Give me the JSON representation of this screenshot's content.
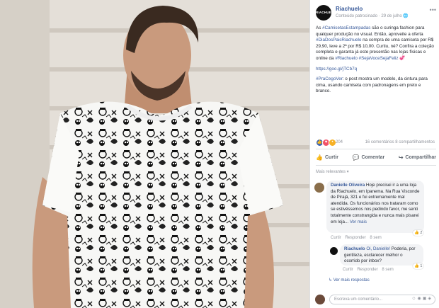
{
  "post": {
    "page_name": "Riachuelo",
    "logo_text": "RIACHUELO",
    "author_meta": "Conteúdo patrocinado",
    "date": "29 de julho",
    "body_p1_parts": [
      {
        "text": "As ",
        "type": "text"
      },
      {
        "text": "#CamisetasEstampadas",
        "type": "link"
      },
      {
        "text": " são o curinga fashion para qualquer produção no visual. Então, aproveite a oferta ",
        "type": "text"
      },
      {
        "text": "#DiaDosPaisRiachuelo",
        "type": "link"
      },
      {
        "text": " na compra de uma camiseta por R$ 29,90, leve a 2ª por R$ 10,00. Curtiu, né? Confira a coleção completa e garanta já este presentão nas lojas físicas e online da ",
        "type": "text"
      },
      {
        "text": "#Riachuelo",
        "type": "link"
      },
      {
        "text": " ",
        "type": "text"
      },
      {
        "text": "#SejaVoceSejaFeliz",
        "type": "link"
      },
      {
        "text": " 💞",
        "type": "text"
      }
    ],
    "short_link": "https://goo.gl/jTCb7q",
    "body_p3_tag": "#PraCegoVer",
    "body_p3_text": ": o post mostra um modelo, da cintura para cima, usando camiseta com padronagens em preto e branco."
  },
  "reactions": {
    "count": "204",
    "comments": "16 comentários",
    "shares": "8 compartilhamentos"
  },
  "actions": {
    "like": "Curtir",
    "comment": "Comentar",
    "share": "Compartilhar"
  },
  "comments": {
    "sort_label": "Mais relevantes ▾",
    "first": {
      "author": "Danielle Oliveira",
      "text": "Hoje precisei ir a uma loja da Riachuelo, em Ipanema. Na Rua Visconde de Pirajá, 321 e fui extremamente mal atendida. Os funcionários nos trataram como se estivéssemos nos pedindo favor, me senti totalmente constrangida e nunca mais pisarei em loja...",
      "see_more": "Ver mais",
      "like": "Curtir",
      "reply": "Responder",
      "time": "8 sem",
      "reaction_badge": "2"
    },
    "reply": {
      "author": "Riachuelo",
      "mention": "Oi, Danielle!",
      "text": "Poderia, por gentileza, esclarecer melhor o ocorrido por inbox?",
      "like": "Curtir",
      "reply": "Responder",
      "time": "8 sem",
      "reaction_badge": "1"
    },
    "more_replies": "Ver mais respostas",
    "write_placeholder": "Escreva um comentário..."
  },
  "colors": {
    "link": "#365899",
    "like_blue": "#4267b2",
    "heart_red": "#f25268"
  }
}
